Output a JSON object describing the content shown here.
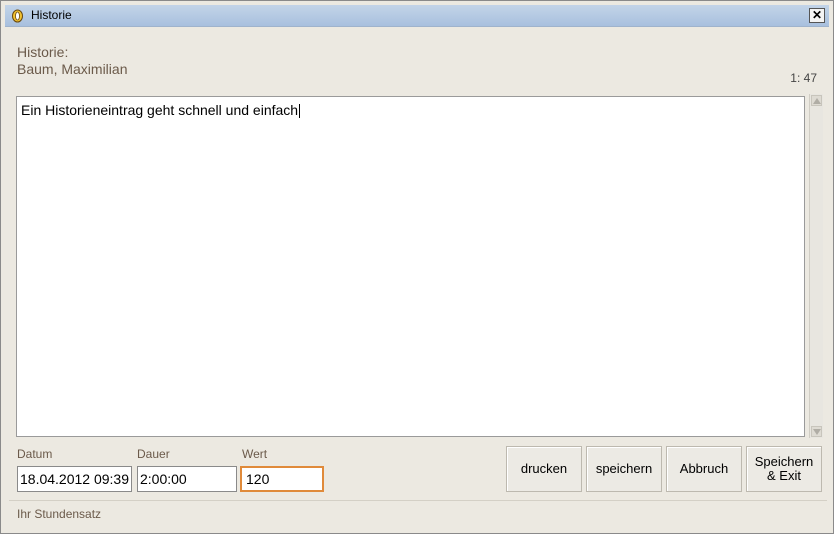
{
  "window": {
    "title": "Historie",
    "close_symbol": "✕"
  },
  "header": {
    "label": "Historie:",
    "name": "Baum, Maximilian",
    "counter": "1:  47"
  },
  "editor": {
    "text": "Ein Historieneintrag geht schnell und einfach"
  },
  "fields": {
    "datum": {
      "label": "Datum",
      "value": "18.04.2012 09:39"
    },
    "dauer": {
      "label": "Dauer",
      "value": "2:00:00"
    },
    "wert": {
      "label": "Wert",
      "value": "120"
    }
  },
  "buttons": {
    "drucken": "drucken",
    "speichern": "speichern",
    "abbruch": "Abbruch",
    "speichern_exit_line1": "Speichern",
    "speichern_exit_line2": "& Exit"
  },
  "status": {
    "text": "Ihr Stundensatz"
  },
  "colors": {
    "accent_focus": "#e08a3a",
    "label_text": "#6b5a4a",
    "window_bg": "#ece9e1"
  }
}
